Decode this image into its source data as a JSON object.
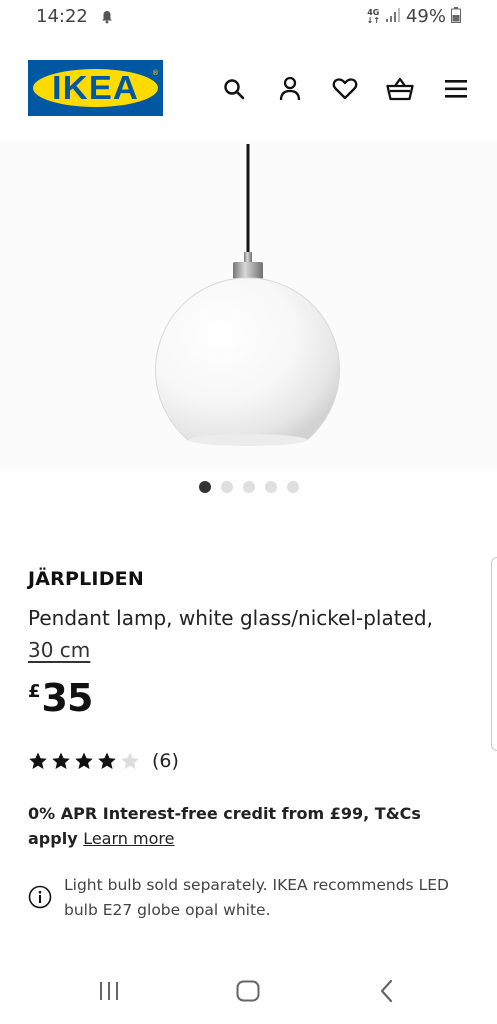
{
  "status_bar": {
    "time": "14:22",
    "network_top": "4G",
    "network_bottom": "↓↑",
    "battery": "49%"
  },
  "header": {
    "logo_text": "IKEA",
    "logo_reg": "®",
    "icons": [
      "search-icon",
      "account-icon",
      "wishlist-heart-icon",
      "shopping-basket-icon",
      "menu-icon"
    ]
  },
  "gallery": {
    "dot_count": 5,
    "active_index": 0
  },
  "product": {
    "name": "JÄRPLIDEN",
    "description": "Pendant lamp, white glass/nickel-plated,",
    "size_link": "30 cm",
    "price_currency": "£",
    "price_amount": "35",
    "rating_stars": 4,
    "rating_max": 5,
    "rating_count": "(6)"
  },
  "credit": {
    "text": "0% APR Interest-free credit from £99, T&Cs apply",
    "link": "Learn more"
  },
  "info": {
    "text": "Light bulb sold separately. IKEA recommends LED bulb E27 globe opal white."
  },
  "colors": {
    "ikea_blue": "#0058a3",
    "ikea_yellow": "#ffdb00",
    "star_filled": "#111111",
    "star_empty": "#dddddd"
  }
}
